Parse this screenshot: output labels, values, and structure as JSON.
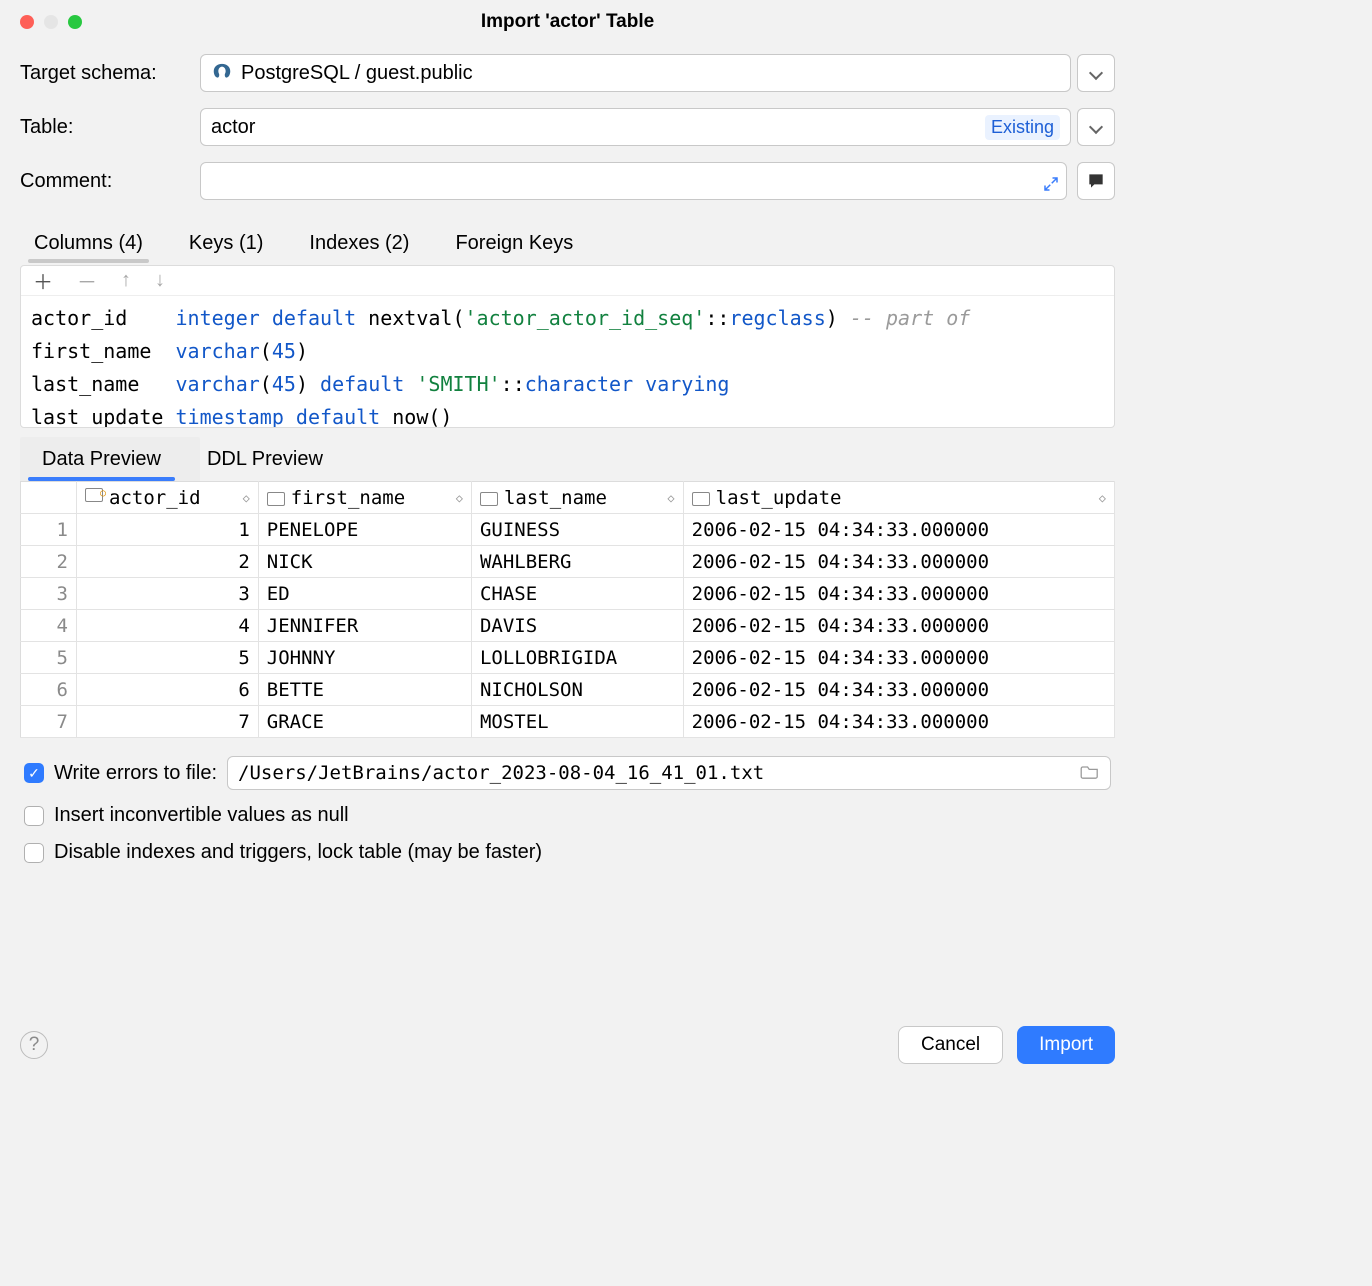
{
  "window": {
    "title": "Import 'actor' Table"
  },
  "form": {
    "target_schema_label": "Target schema:",
    "target_schema_value": "PostgreSQL / guest.public",
    "table_label": "Table:",
    "table_value": "actor",
    "table_badge": "Existing",
    "comment_label": "Comment:",
    "comment_value": ""
  },
  "schema_tabs": {
    "columns": "Columns (4)",
    "keys": "Keys (1)",
    "indexes": "Indexes (2)",
    "foreign_keys": "Foreign Keys"
  },
  "columns_ddl": [
    {
      "name": "actor_id",
      "type": "integer",
      "rest_html": " <span class='kw'>default</span> nextval(<span class='str'>'actor_actor_id_seq'</span>::<span class='kw'>regclass</span>) <span class='cmt'>-- part of</span>"
    },
    {
      "name": "first_name",
      "type": "varchar",
      "rest_html": "(<span class='num'>45</span>)"
    },
    {
      "name": "last_name",
      "type": "varchar",
      "rest_html": "(<span class='num'>45</span>) <span class='kw'>default</span> <span class='str'>'SMITH'</span>::<span class='kw'>character varying</span>"
    },
    {
      "name": "last_update",
      "type": "timestamp",
      "rest_html": " <span class='kw'>default</span> now()"
    }
  ],
  "preview_tabs": {
    "data": "Data Preview",
    "ddl": "DDL Preview"
  },
  "preview": {
    "headers": [
      "actor_id",
      "first_name",
      "last_name",
      "last_update"
    ],
    "rows": [
      {
        "n": 1,
        "actor_id": 1,
        "first_name": "PENELOPE",
        "last_name": "GUINESS",
        "last_update": "2006-02-15 04:34:33.000000"
      },
      {
        "n": 2,
        "actor_id": 2,
        "first_name": "NICK",
        "last_name": "WAHLBERG",
        "last_update": "2006-02-15 04:34:33.000000"
      },
      {
        "n": 3,
        "actor_id": 3,
        "first_name": "ED",
        "last_name": "CHASE",
        "last_update": "2006-02-15 04:34:33.000000"
      },
      {
        "n": 4,
        "actor_id": 4,
        "first_name": "JENNIFER",
        "last_name": "DAVIS",
        "last_update": "2006-02-15 04:34:33.000000"
      },
      {
        "n": 5,
        "actor_id": 5,
        "first_name": "JOHNNY",
        "last_name": "LOLLOBRIGIDA",
        "last_update": "2006-02-15 04:34:33.000000"
      },
      {
        "n": 6,
        "actor_id": 6,
        "first_name": "BETTE",
        "last_name": "NICHOLSON",
        "last_update": "2006-02-15 04:34:33.000000"
      },
      {
        "n": 7,
        "actor_id": 7,
        "first_name": "GRACE",
        "last_name": "MOSTEL",
        "last_update": "2006-02-15 04:34:33.000000"
      }
    ]
  },
  "options": {
    "write_errors_label": "Write errors to file:",
    "write_errors_checked": true,
    "error_path": "/Users/JetBrains/actor_2023-08-04_16_41_01.txt",
    "insert_null_label": "Insert inconvertible values as null",
    "insert_null_checked": false,
    "disable_indexes_label": "Disable indexes and triggers, lock table (may be faster)",
    "disable_indexes_checked": false
  },
  "buttons": {
    "cancel": "Cancel",
    "import": "Import"
  }
}
